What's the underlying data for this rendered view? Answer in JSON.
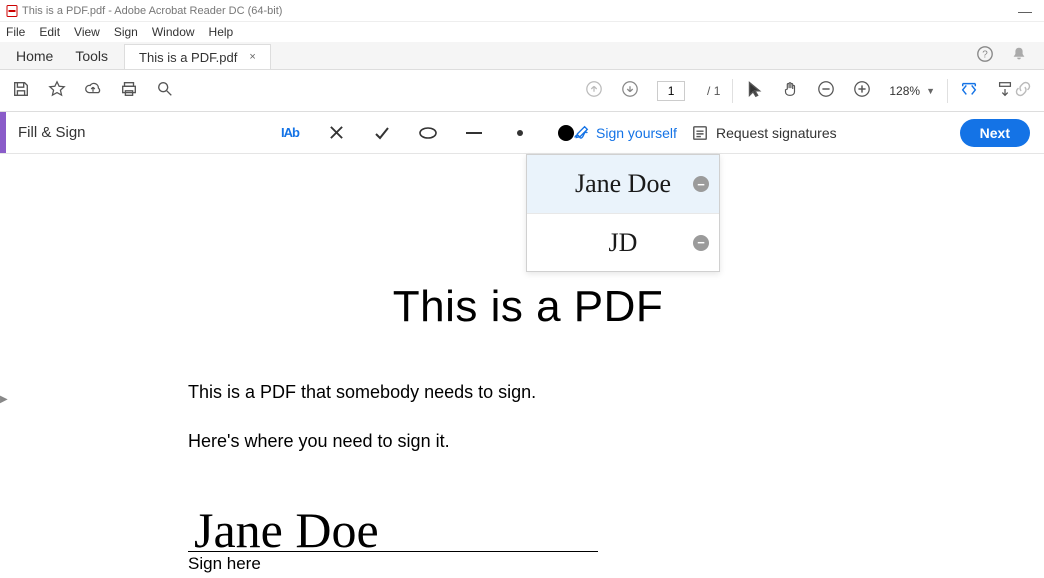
{
  "titlebar": {
    "title": "This is a PDF.pdf - Adobe Acrobat Reader DC (64-bit)"
  },
  "menubar": {
    "items": [
      "File",
      "Edit",
      "View",
      "Sign",
      "Window",
      "Help"
    ]
  },
  "nav": {
    "home": "Home",
    "tools": "Tools"
  },
  "docTab": {
    "label": "This is a PDF.pdf",
    "close": "×"
  },
  "toolbar": {
    "page_current": "1",
    "page_total": "/ 1",
    "zoom": "128%"
  },
  "fillSign": {
    "title": "Fill & Sign",
    "iab": "IAb",
    "sign_yourself": "Sign yourself",
    "request_signatures": "Request signatures",
    "next": "Next"
  },
  "sigDropdown": {
    "items": [
      {
        "label": "Jane Doe"
      },
      {
        "label": "JD"
      }
    ],
    "minus": "−"
  },
  "document": {
    "title": "This is a PDF",
    "p1": "This is a PDF that somebody needs to sign.",
    "p2": "Here's where you need to sign it.",
    "signature_text": "Jane Doe",
    "sign_here": "Sign here"
  }
}
